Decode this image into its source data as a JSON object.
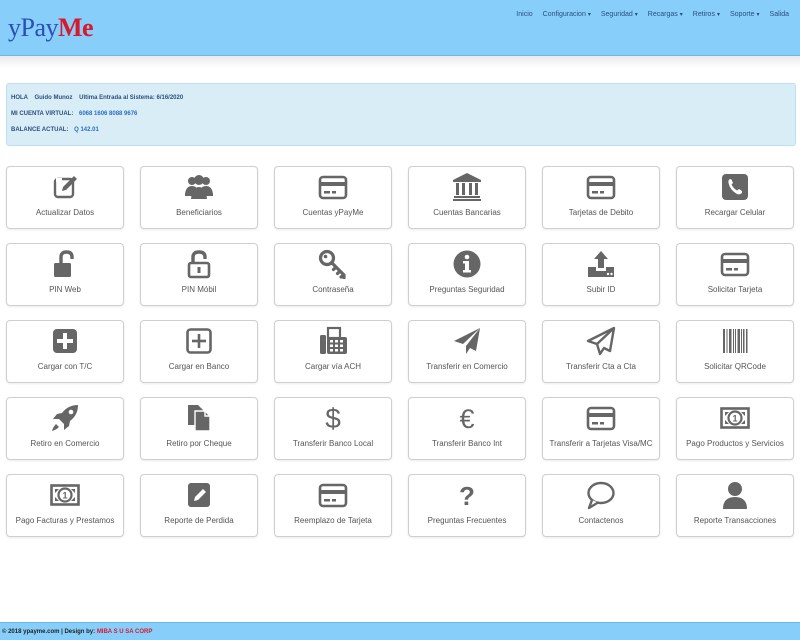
{
  "brand": {
    "y": "y",
    "pay": "Pay",
    "me": "Me"
  },
  "nav": [
    {
      "label": "Inicio",
      "dropdown": false
    },
    {
      "label": "Configuracion",
      "dropdown": true
    },
    {
      "label": "Seguridad",
      "dropdown": true
    },
    {
      "label": "Recargas",
      "dropdown": true
    },
    {
      "label": "Retiros",
      "dropdown": true
    },
    {
      "label": "Soporte",
      "dropdown": true
    },
    {
      "label": "Salida",
      "dropdown": false
    }
  ],
  "info": {
    "greeting_label": "HOLA",
    "user_name": "Guido Munoz",
    "last_login_label": "Ultima Entrada al Sistema:",
    "last_login_value": "6/16/2020",
    "account_label": "MI CUENTA VIRTUAL:",
    "account_value": "6068 1606 8088 9676",
    "balance_label": "BALANCE ACTUAL:",
    "balance_value": "Q 142.01"
  },
  "tiles": [
    {
      "label": "Actualizar Datos",
      "icon": "edit-icon"
    },
    {
      "label": "Beneficiarios",
      "icon": "users-icon"
    },
    {
      "label": "Cuentas yPayMe",
      "icon": "credit-card-icon"
    },
    {
      "label": "Cuentas Bancarias",
      "icon": "bank-icon"
    },
    {
      "label": "Tarjetas de Debito",
      "icon": "credit-card-icon"
    },
    {
      "label": "Recargar Celular",
      "icon": "phone-icon"
    },
    {
      "label": "PIN Web",
      "icon": "unlock-icon"
    },
    {
      "label": "PIN Móbil",
      "icon": "unlock-alt-icon"
    },
    {
      "label": "Contraseña",
      "icon": "key-icon"
    },
    {
      "label": "Preguntas Seguridad",
      "icon": "info-icon"
    },
    {
      "label": "Subir ID",
      "icon": "upload-icon"
    },
    {
      "label": "Solicitar Tarjeta",
      "icon": "credit-card-icon"
    },
    {
      "label": "Cargar con T/C",
      "icon": "plus-square-icon"
    },
    {
      "label": "Cargar en Banco",
      "icon": "plus-square-outline-icon"
    },
    {
      "label": "Cargar vía ACH",
      "icon": "fax-icon"
    },
    {
      "label": "Transferir en Comercio",
      "icon": "paper-plane-icon"
    },
    {
      "label": "Transferir Cta a Cta",
      "icon": "paper-plane-outline-icon"
    },
    {
      "label": "Solicitar QRCode",
      "icon": "barcode-icon"
    },
    {
      "label": "Retiro en Comercio",
      "icon": "rocket-icon"
    },
    {
      "label": "Retiro por Cheque",
      "icon": "files-icon"
    },
    {
      "label": "Transferir Banco Local",
      "icon": "dollar-icon"
    },
    {
      "label": "Transferir Banco Int",
      "icon": "euro-icon"
    },
    {
      "label": "Transferir a Tarjetas Visa/MC",
      "icon": "credit-card-icon"
    },
    {
      "label": "Pago Productos y Servicios",
      "icon": "money-icon"
    },
    {
      "label": "Pago Facturas y Prestamos",
      "icon": "money-icon"
    },
    {
      "label": "Reporte de Perdida",
      "icon": "edit-square-icon"
    },
    {
      "label": "Reemplazo de Tarjeta",
      "icon": "credit-card-icon"
    },
    {
      "label": "Preguntas Frecuentes",
      "icon": "question-icon"
    },
    {
      "label": "Contactenos",
      "icon": "comment-icon"
    },
    {
      "label": "Reporte Transacciones",
      "icon": "user-icon"
    }
  ],
  "footer": {
    "copyright": "© 2018 ypayme.com | Design by:",
    "designer": "MIBA S U SA CORP"
  },
  "colors": {
    "header_bg": "#87cefa",
    "info_bg": "#d9edf7",
    "icon": "#666666",
    "brand_red": "#d8192c",
    "brand_blue": "#2a4fb8"
  }
}
